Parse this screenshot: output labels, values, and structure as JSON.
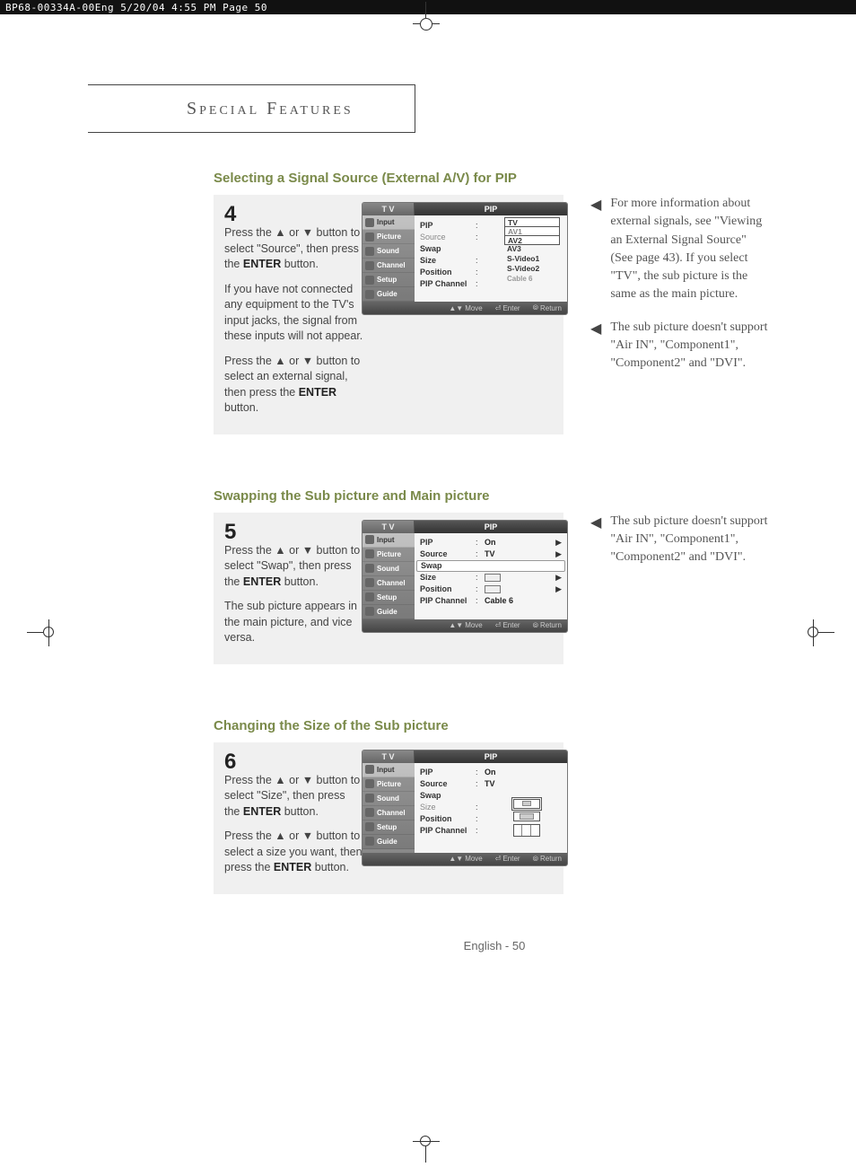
{
  "doc_header": "BP68-00334A-00Eng  5/20/04  4:55 PM  Page 50",
  "page_title": "Special Features",
  "sections": {
    "s1": {
      "heading": "Selecting a Signal Source (External A/V) for PIP",
      "step_num": "4",
      "para1a": "Press the ▲ or ▼ button to select \"Source\", then press the ",
      "para1b": "ENTER",
      "para1c": " button.",
      "para2": "If you have not connected any equipment to the TV's input jacks, the signal from these inputs will not appear.",
      "para3a": "Press the ▲ or ▼ button to select an external signal, then press the ",
      "para3b": "ENTER",
      "para3c": " button.",
      "note1": "For more information about external signals, see \"Viewing an External Signal Source\" (See page 43). If you select \"TV\", the sub picture is the same as the main picture.",
      "note2": "The sub picture doesn't support \"Air IN\", \"Component1\", \"Component2\" and \"DVI\"."
    },
    "s2": {
      "heading": "Swapping the Sub picture and Main picture",
      "step_num": "5",
      "para1a": "Press the ▲ or ▼ button to select \"Swap\", then press the ",
      "para1b": "ENTER",
      "para1c": " button.",
      "para2": "The sub picture appears in the main picture, and vice versa.",
      "note1": "The sub picture doesn't support \"Air IN\", \"Component1\", \"Component2\" and \"DVI\"."
    },
    "s3": {
      "heading": "Changing the Size of the Sub picture",
      "step_num": "6",
      "para1a": "Press the ▲ or ▼ button to select \"Size\", then press the ",
      "para1b": "ENTER",
      "para1c": " button.",
      "para2a": "Press the ▲ or ▼ button to select a size you want, then press the ",
      "para2b": "ENTER",
      "para2c": " button."
    }
  },
  "osd": {
    "tab_tv": "T V",
    "tab_pip": "PIP",
    "sidebar": [
      "Input",
      "Picture",
      "Sound",
      "Channel",
      "Setup",
      "Guide"
    ],
    "rows": {
      "pip": "PIP",
      "source": "Source",
      "swap": "Swap",
      "size": "Size",
      "position": "Position",
      "pipchannel": "PIP Channel"
    },
    "vals": {
      "on": "On",
      "tv": "TV",
      "cable6": "Cable   6"
    },
    "source_list": [
      "TV",
      "AV1",
      "AV2",
      "AV3",
      "S-Video1",
      "S-Video2",
      "Cable  6"
    ],
    "footer": {
      "move": "Move",
      "enter": "Enter",
      "return": "Return"
    }
  },
  "footer": "English - 50"
}
